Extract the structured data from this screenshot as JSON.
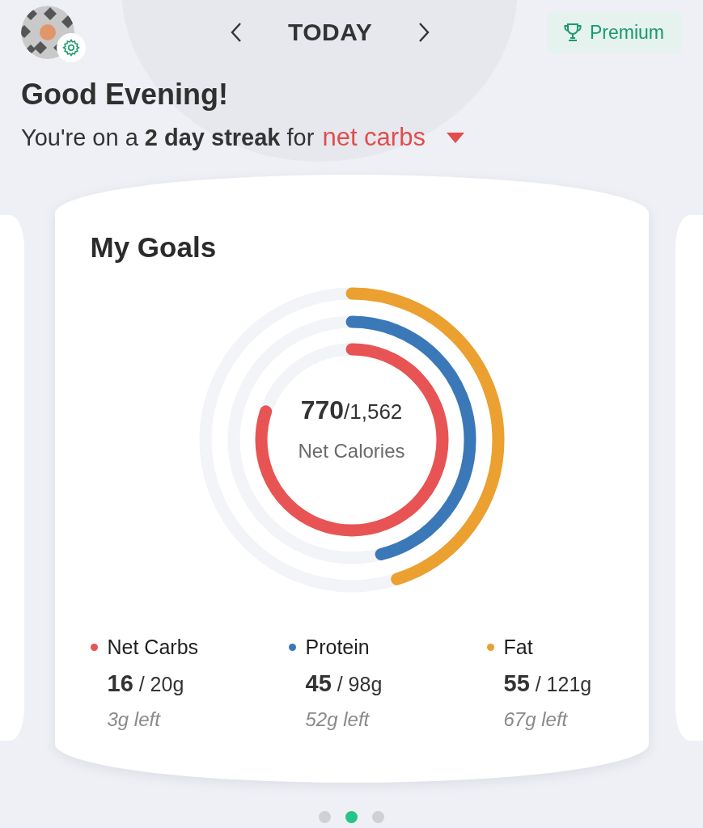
{
  "header": {
    "date_label": "TODAY",
    "premium": "Premium"
  },
  "greeting": "Good Evening!",
  "streak": {
    "text": "You're on a **2 day streak** for",
    "nutrient": "net carbs"
  },
  "card": {
    "title": "My Goals",
    "rings": [
      {
        "color": "#e85454",
        "level": 0.8
      },
      {
        "color": "#3b78b8",
        "level": 0.46
      },
      {
        "color": "#eba02f",
        "level": 0.45
      }
    ],
    "summary": {
      "value": "770",
      "total": "/1,562",
      "label": "Net Calories"
    },
    "macros": [
      {
        "name": "Net Carbs",
        "color": "#e85454",
        "amount": "**16** / 20g",
        "left": "3g left"
      },
      {
        "name": "Protein",
        "color": "#3b78b8",
        "amount": "**45** / 98g",
        "left": "52g left"
      },
      {
        "name": "Fat",
        "color": "#eba02f",
        "amount": "**55** / 121g",
        "left": "67g left"
      }
    ]
  },
  "pager": [
    {
      "selected": false
    },
    {
      "selected": true
    },
    {
      "selected": false
    }
  ]
}
